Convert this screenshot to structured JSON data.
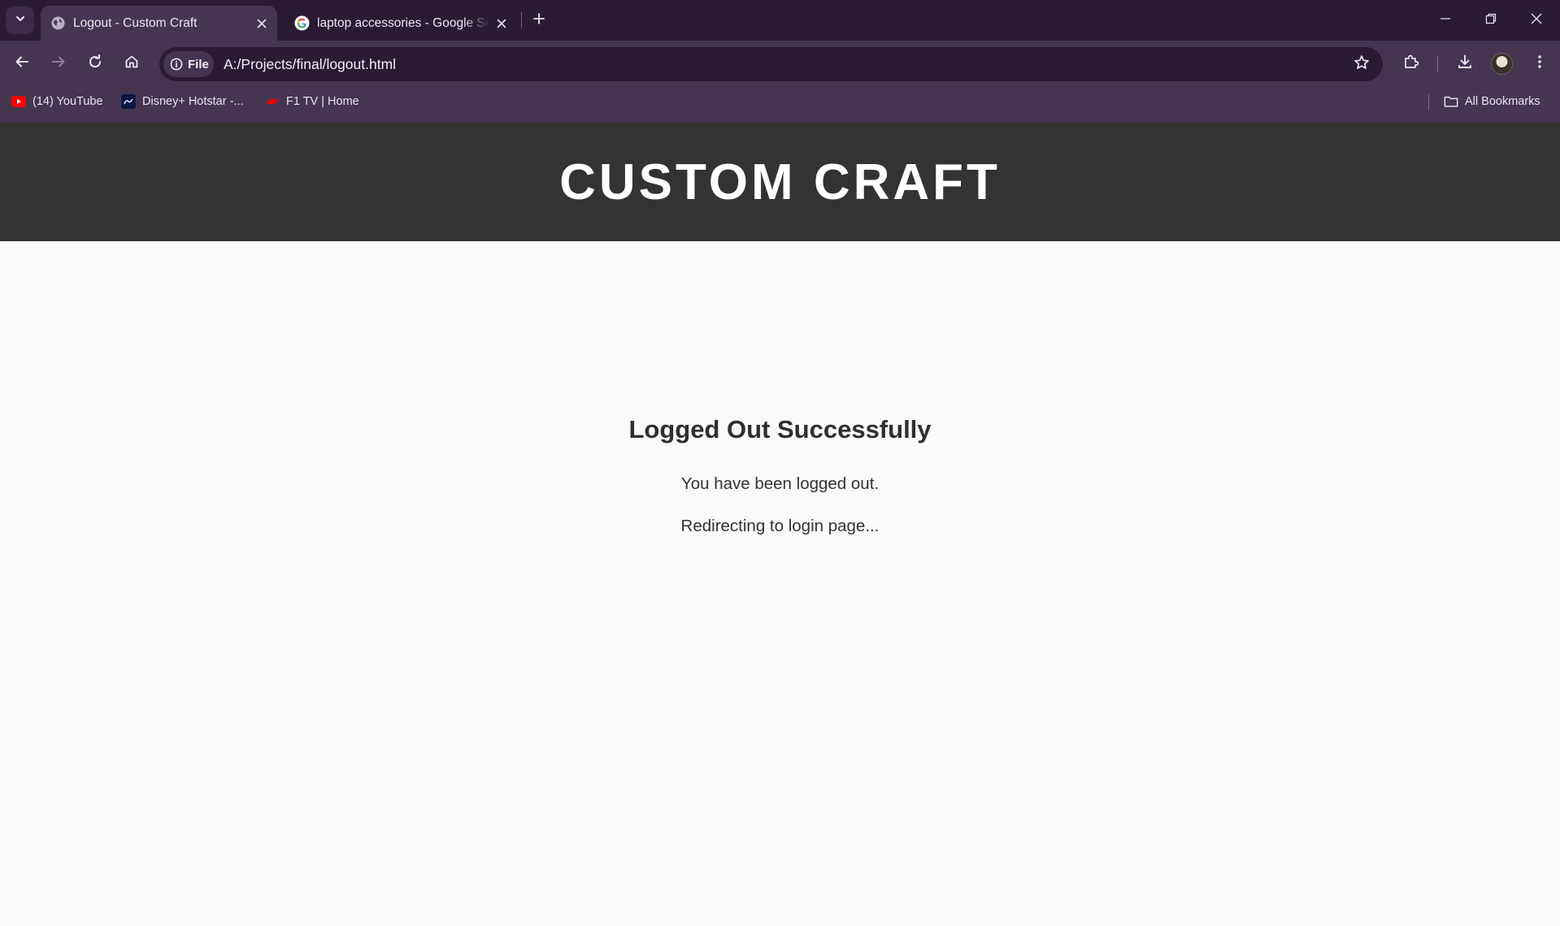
{
  "browser": {
    "tabs": [
      {
        "title": "Logout - Custom Craft",
        "active": true,
        "favicon": "globe-icon"
      },
      {
        "title": "laptop accessories - Google Search",
        "active": false,
        "favicon": "google-icon"
      }
    ],
    "address_bar": {
      "security_chip": "File",
      "url": "A:/Projects/final/logout.html"
    },
    "bookmarks": [
      {
        "label": "(14) YouTube",
        "icon": "youtube-icon"
      },
      {
        "label": "Disney+ Hotstar -...",
        "icon": "hotstar-icon"
      },
      {
        "label": "F1 TV | Home",
        "icon": "f1-icon"
      }
    ],
    "all_bookmarks_label": "All Bookmarks",
    "colors": {
      "tabstrip": "#2a1b33",
      "toolbar": "#463550",
      "omnibox": "#2a1b33"
    }
  },
  "page": {
    "header_title": "CUSTOM CRAFT",
    "heading": "Logged Out Successfully",
    "message": "You have been logged out.",
    "redirect_text": "Redirecting to login page...",
    "colors": {
      "header_bg": "#333333",
      "page_bg": "#f9f9f9",
      "text": "#333333"
    }
  }
}
